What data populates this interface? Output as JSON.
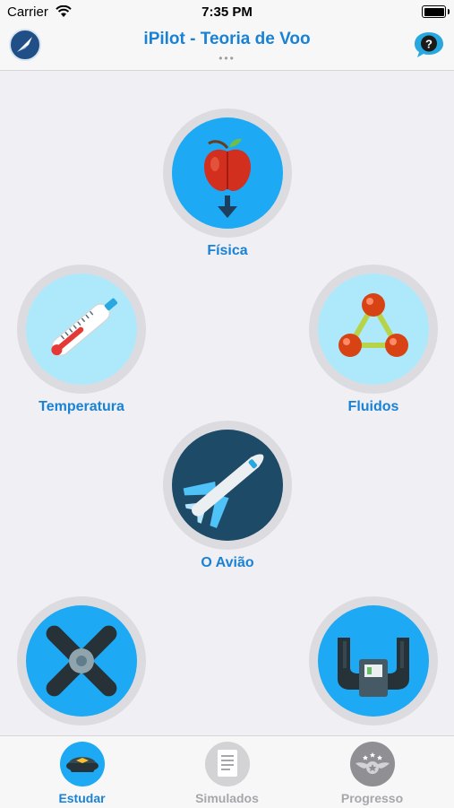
{
  "status_bar": {
    "carrier": "Carrier",
    "time": "7:35 PM"
  },
  "nav": {
    "title": "iPilot - Teoria de Voo",
    "dots": "•••"
  },
  "topics": {
    "fisica": {
      "label": "Física"
    },
    "temperatura": {
      "label": "Temperatura"
    },
    "fluidos": {
      "label": "Fluidos"
    },
    "aviao": {
      "label": "O Avião"
    }
  },
  "tabs": {
    "estudar": {
      "label": "Estudar",
      "color": "#1a82d5"
    },
    "simulados": {
      "label": "Simulados",
      "color": "#a7a7ab"
    },
    "progresso": {
      "label": "Progresso",
      "color": "#a7a7ab"
    }
  },
  "colors": {
    "accent": "#1a82d5",
    "background": "#efeff4"
  }
}
